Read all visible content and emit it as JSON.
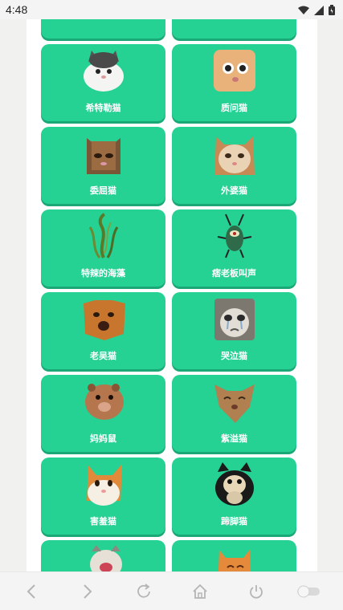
{
  "status_bar": {
    "time": "4:48"
  },
  "cards": [
    {
      "label": "",
      "icon": "cat-image"
    },
    {
      "label": "",
      "icon": "cat-image"
    },
    {
      "label": "希特勒猫",
      "icon": "white-cat-image"
    },
    {
      "label": "质问猫",
      "icon": "orange-cat-image"
    },
    {
      "label": "委屈猫",
      "icon": "tabby-cat-image"
    },
    {
      "label": "外婆猫",
      "icon": "calico-cat-image"
    },
    {
      "label": "特辣的海藻",
      "icon": "seaweed-image"
    },
    {
      "label": "痞老板叫声",
      "icon": "plankton-image"
    },
    {
      "label": "老吴猫",
      "icon": "orange-cat-image"
    },
    {
      "label": "哭泣猫",
      "icon": "crying-cat-image"
    },
    {
      "label": "妈妈鼠",
      "icon": "hamster-image"
    },
    {
      "label": "紫溢猫",
      "icon": "cat-image"
    },
    {
      "label": "害羞猫",
      "icon": "shy-cat-image"
    },
    {
      "label": "蹄脚猫",
      "icon": "black-white-cat-image"
    },
    {
      "label": "",
      "icon": "laughing-cat-image"
    },
    {
      "label": "",
      "icon": "orange-cat-image"
    }
  ],
  "nav_bar": {
    "items": [
      "back-icon",
      "forward-icon",
      "refresh-icon",
      "home-icon",
      "power-icon",
      "toggle-icon"
    ]
  },
  "colors": {
    "card": "#26d194",
    "card_shadow": "#1ba877",
    "label": "#ffffff"
  }
}
